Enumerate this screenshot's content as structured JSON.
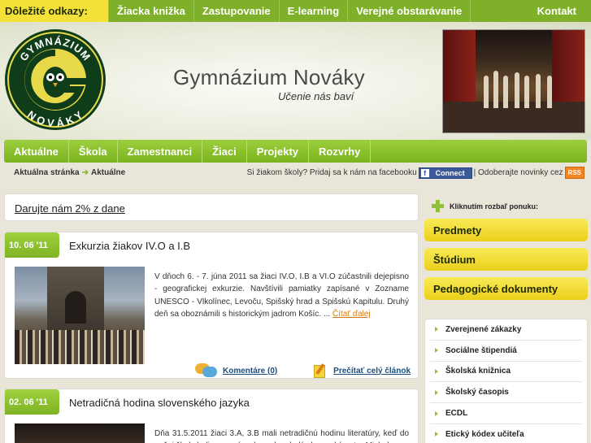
{
  "topbar": {
    "lead": "Dôležité odkazy:",
    "links": [
      "Žiacka knižka",
      "Zastupovanie",
      "E-learning",
      "Verejné obstarávanie"
    ],
    "contact": "Kontakt"
  },
  "header": {
    "logo_text_top": "GYMNÁZIUM",
    "logo_text_bottom": "NOVÁKY",
    "title": "Gymnázium Nováky",
    "subtitle": "Učenie nás baví"
  },
  "mainnav": [
    "Aktuálne",
    "Škola",
    "Zamestnanci",
    "Žiaci",
    "Projekty",
    "Rozvrhy"
  ],
  "breadcrumb": {
    "label": "Aktuálna stránka",
    "current": "Aktuálne"
  },
  "social": {
    "fb_text": "Si žiakom školy? Pridaj sa k nám na facebooku",
    "fb_button": "Connect",
    "rss_text": "| Odoberajte novinky cez",
    "rss_badge": "RSS"
  },
  "donate": "Darujte nám 2% z dane",
  "articles": [
    {
      "date": "10. 06 '11",
      "title": "Exkurzia žiakov IV.O a I.B",
      "text": "V dňoch 6. - 7. júna 2011 sa žiaci IV.O, I.B a VI.O zúčastnili dejepisno - geografickej exkurzie. Navštívili pamiatky zapísané v Zozname UNESCO - Vlkolínec, Levoču, Spišský hrad a Spišskú Kapitulu. Druhý deň sa oboznámili s historickým jadrom Košíc. ...",
      "more": "Čítať ďalej",
      "comments": "Komentáre (0)",
      "read_all": "Prečítať celý článok"
    },
    {
      "date": "02. 06 '11",
      "title": "Netradičná hodina slovenského jazyka",
      "text": "Dňa 31.5.2011 žiaci 3.A, 3.B mali netradičnú hodinu literatúry, keď do našej školy boli pozvaní na besedu mladý slovenský autor Michal"
    }
  ],
  "sidebar": {
    "expand_hint": "Kliknutím rozbaľ ponuku:",
    "accordions": [
      "Predmety",
      "Štúdium",
      "Pedagogické dokumenty"
    ],
    "items": [
      "Zverejnené zákazky",
      "Sociálne štipendiá",
      "Školská knižnica",
      "Školský časopis",
      "ECDL",
      "Etický kódex učiteľa"
    ]
  }
}
